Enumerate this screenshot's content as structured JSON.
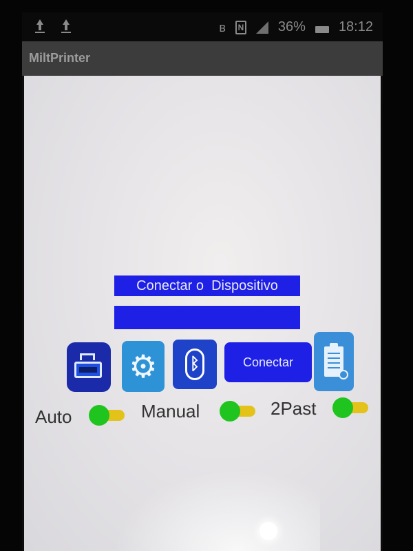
{
  "status_bar": {
    "battery_percent": "36%",
    "time": "18:12",
    "icons": [
      "upload-icon",
      "upload-icon",
      "bluetooth-icon",
      "nfc-icon",
      "signal-icon",
      "battery-icon"
    ]
  },
  "action_bar": {
    "title": "MiltPrinter"
  },
  "main": {
    "header_label": "Conectar o  Dispositivo",
    "device_field_value": "",
    "connect_button_label": "Conectar",
    "toolbar_icons": [
      "printer-icon",
      "gear-icon",
      "bluetooth-icon",
      "clipboard-icon"
    ]
  },
  "toggles": [
    {
      "label": "Auto",
      "state": "on"
    },
    {
      "label": "Manual",
      "state": "on"
    },
    {
      "label": "2Past",
      "state": "on"
    }
  ],
  "colors": {
    "accent_blue": "#1e20e6",
    "toggle_thumb": "#1fc41f",
    "toggle_track": "#e3c21a"
  }
}
